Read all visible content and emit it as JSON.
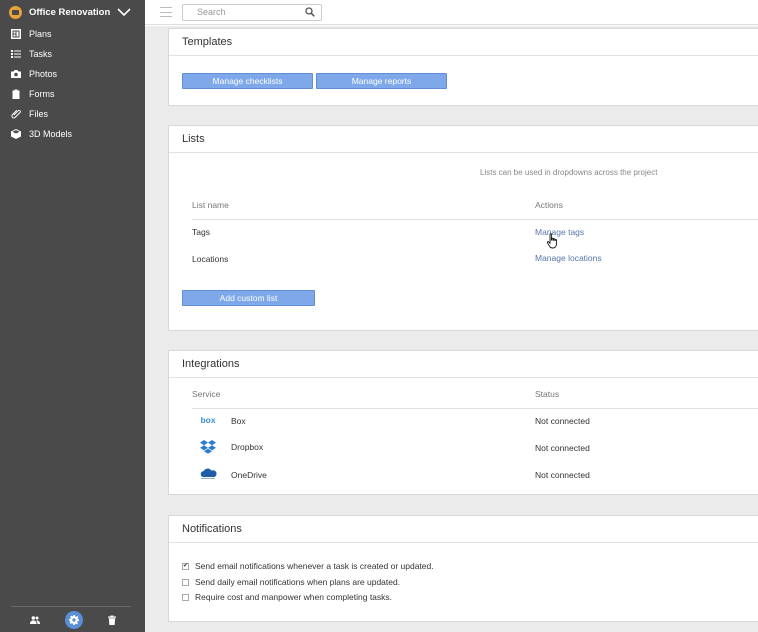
{
  "project": {
    "name": "Office Renovation"
  },
  "nav": [
    {
      "label": "Plans",
      "icon": "plans-icon"
    },
    {
      "label": "Tasks",
      "icon": "tasks-icon"
    },
    {
      "label": "Photos",
      "icon": "camera-icon"
    },
    {
      "label": "Forms",
      "icon": "clipboard-icon"
    },
    {
      "label": "Files",
      "icon": "paperclip-icon"
    },
    {
      "label": "3D Models",
      "icon": "cube-icon"
    }
  ],
  "footer_icons": [
    "people-icon",
    "gear-icon",
    "trash-icon"
  ],
  "search": {
    "placeholder": "Search"
  },
  "templates": {
    "title": "Templates",
    "buttons": [
      "Manage checklists",
      "Manage reports"
    ]
  },
  "lists": {
    "title": "Lists",
    "note": "Lists can be used in dropdowns across the project",
    "columns": [
      "List name",
      "Actions"
    ],
    "rows": [
      {
        "name": "Tags",
        "action": "Manage tags"
      },
      {
        "name": "Locations",
        "action": "Manage locations"
      }
    ],
    "add_button": "Add custom list"
  },
  "integrations": {
    "title": "Integrations",
    "columns": [
      "Service",
      "Status"
    ],
    "rows": [
      {
        "name": "Box",
        "status": "Not connected",
        "icon": "box-logo-icon",
        "logo_text": "box"
      },
      {
        "name": "Dropbox",
        "status": "Not connected",
        "icon": "dropbox-logo-icon"
      },
      {
        "name": "OneDrive",
        "status": "Not connected",
        "icon": "onedrive-logo-icon"
      }
    ]
  },
  "notifications": {
    "title": "Notifications",
    "options": [
      {
        "label": "Send email notifications whenever a task is created or updated.",
        "checked": true
      },
      {
        "label": "Send daily email notifications when plans are updated.",
        "checked": false
      },
      {
        "label": "Require cost and manpower when completing tasks.",
        "checked": false
      }
    ]
  },
  "colors": {
    "sidebar": "#4a4a4a",
    "accent": "#7ea8ea",
    "link": "#5577aa",
    "background": "#ebebeb"
  }
}
